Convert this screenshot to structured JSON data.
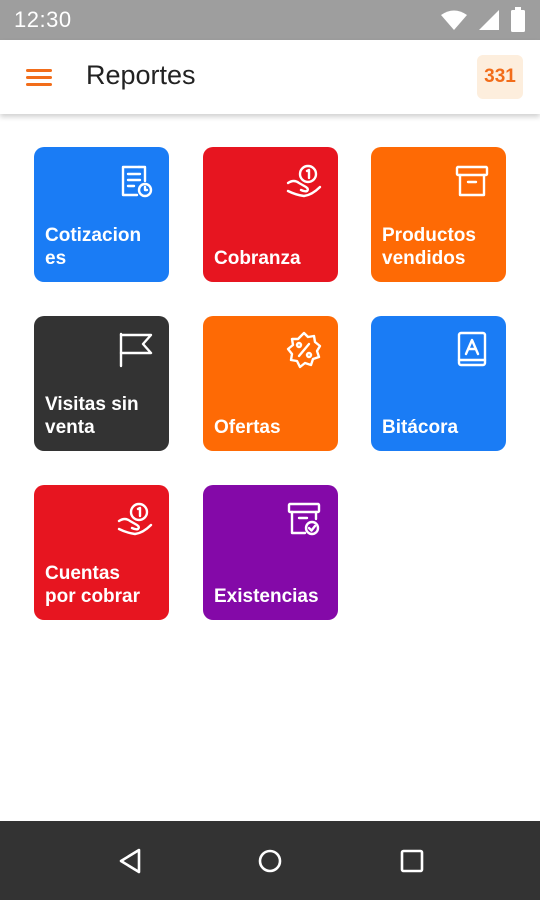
{
  "status_bar": {
    "time": "12:30",
    "icons": [
      "wifi-icon",
      "signal-icon",
      "battery-icon"
    ]
  },
  "app_bar": {
    "menu_icon": "hamburger-menu-icon",
    "title": "Reportes",
    "badge": "331"
  },
  "colors": {
    "accent": "#f26d1a",
    "blue": "#1a7cf5",
    "red": "#e71520",
    "orange": "#fe6a05",
    "dark": "#333333",
    "purple": "#8409a8"
  },
  "tiles": [
    {
      "label": "Cotizacion\nes",
      "icon": "quote-document-icon",
      "color": "#1a7cf5"
    },
    {
      "label": "Cobranza",
      "icon": "hand-coin-icon",
      "color": "#e71520"
    },
    {
      "label": "Productos\nvendidos",
      "icon": "archive-box-icon",
      "color": "#fe6a05"
    },
    {
      "label": "Visitas sin\nventa",
      "icon": "flag-icon",
      "color": "#333333"
    },
    {
      "label": "Ofertas",
      "icon": "discount-badge-icon",
      "color": "#fe6a05"
    },
    {
      "label": "Bitácora",
      "icon": "address-book-icon",
      "color": "#1a7cf5"
    },
    {
      "label": "Cuentas\npor cobrar",
      "icon": "hand-coin-icon",
      "color": "#e71520"
    },
    {
      "label": "Existencias",
      "icon": "inventory-check-icon",
      "color": "#8409a8"
    }
  ],
  "nav_bar": {
    "buttons": [
      "back-icon",
      "home-icon",
      "recents-icon"
    ]
  }
}
